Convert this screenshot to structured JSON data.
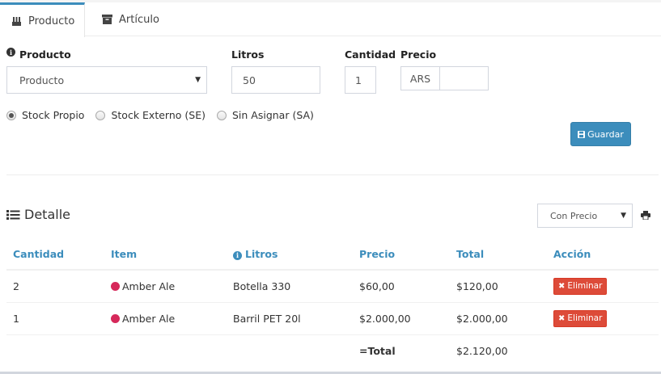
{
  "tabs": [
    {
      "label": "Producto",
      "icon": "beer-crate-icon",
      "active": true
    },
    {
      "label": "Artículo",
      "icon": "archive-box-icon",
      "active": false
    }
  ],
  "form": {
    "producto": {
      "label": "Producto",
      "value": "Producto"
    },
    "litros": {
      "label": "Litros",
      "value": "50"
    },
    "cantidad": {
      "label": "Cantidad",
      "value": "1"
    },
    "precio": {
      "label": "Precio",
      "currency": "ARS",
      "value": ""
    },
    "stock_options": [
      {
        "label": "Stock Propio",
        "checked": true
      },
      {
        "label": "Stock Externo (SE)",
        "checked": false
      },
      {
        "label": "Sin Asignar (SA)",
        "checked": false
      }
    ],
    "save_label": "Guardar"
  },
  "detalle": {
    "title": "Detalle",
    "price_filter": "Con Precio",
    "columns": [
      "Cantidad",
      "Item",
      "Litros",
      "Precio",
      "Total",
      "Acción"
    ],
    "rows": [
      {
        "cantidad": "2",
        "item": "Amber Ale",
        "litros": "Botella 330",
        "precio": "$60,00",
        "total": "$120,00",
        "accion": "Eliminar"
      },
      {
        "cantidad": "1",
        "item": "Amber Ale",
        "litros": "Barril PET 20l",
        "precio": "$2.000,00",
        "total": "$2.000,00",
        "accion": "Eliminar"
      }
    ],
    "total_label": "=Total",
    "total_value": "$2.120,00"
  },
  "colors": {
    "primary": "#3c8dbc",
    "danger": "#dd4b39",
    "item_dot": "#d6285a"
  }
}
